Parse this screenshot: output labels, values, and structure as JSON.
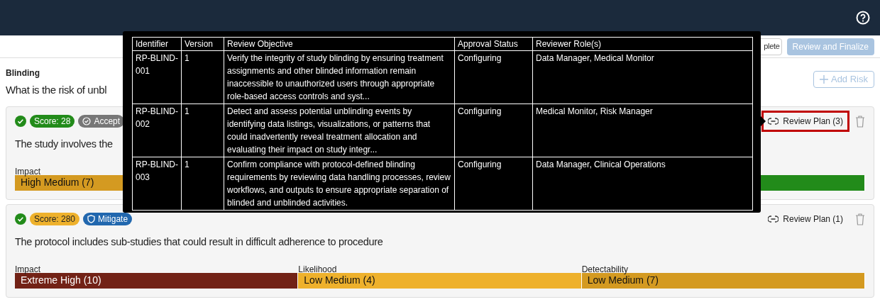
{
  "toolbar": {
    "buttons": [
      {
        "label": "plete",
        "kind": "outline",
        "disabled": false
      },
      {
        "label": "Review and Finalize",
        "kind": "primary",
        "disabled": true
      }
    ]
  },
  "section": {
    "category": "Blinding",
    "question": "What is the risk of unbl",
    "add_button": "Add Risk"
  },
  "risks": [
    {
      "score": {
        "text": "Score: 28",
        "color": "#228b1a"
      },
      "status": {
        "text": "Accept",
        "kind": "accept"
      },
      "description": "The study involves the",
      "review_plan": "Review Plan (3)",
      "review_plan_focused": true,
      "ratings": [
        {
          "kind": "impact",
          "label": "Impact",
          "value": "High Medium (7)",
          "color": "#d49a21"
        },
        {
          "kind": "detectability",
          "color": "#228b1a"
        }
      ]
    },
    {
      "score": {
        "text": "Score: 280",
        "color": "#eeb12c"
      },
      "status": {
        "text": "Mitigate",
        "kind": "mitigate"
      },
      "description": "The protocol includes sub-studies that could result in difficult adherence to procedure",
      "review_plan": "Review Plan (1)",
      "review_plan_focused": false,
      "ratings": [
        {
          "kind": "impact",
          "label": "Impact",
          "value": "Extreme High (10)",
          "color": "#722216"
        },
        {
          "kind": "likelihood",
          "label": "Likelihood",
          "value": "Low Medium (4)",
          "color": "#eeb12c"
        },
        {
          "kind": "detectability",
          "label": "Detectability",
          "value": "Low Medium (7)",
          "color": "#d49a21"
        }
      ]
    }
  ],
  "tooltip": {
    "columns": [
      "Identifier",
      "Version",
      "Review Objective",
      "Approval Status",
      "Reviewer Role(s)"
    ],
    "rows": [
      [
        "RP-BLIND-001",
        "1",
        "Verify the integrity of study blinding by ensuring treatment assignments and other blinded information remain inaccessible to unauthorized users through appropriate role-based access controls and syst...",
        "Configuring",
        "Data Manager, Medical Monitor"
      ],
      [
        "RP-BLIND-002",
        "1",
        "Detect and assess potential unblinding events by identifying data listings, visualizations, or patterns that could inadvertently reveal treatment allocation and evaluating their impact on study integr...",
        "Configuring",
        "Medical Monitor, Risk Manager"
      ],
      [
        "RP-BLIND-003",
        "1",
        "Confirm compliance with protocol-defined blinding requirements by reviewing data handling processes, review workflows, and outputs to ensure appropriate separation of blinded and unblinded activities.",
        "Configuring",
        "Data Manager, Clinical Operations"
      ]
    ]
  }
}
